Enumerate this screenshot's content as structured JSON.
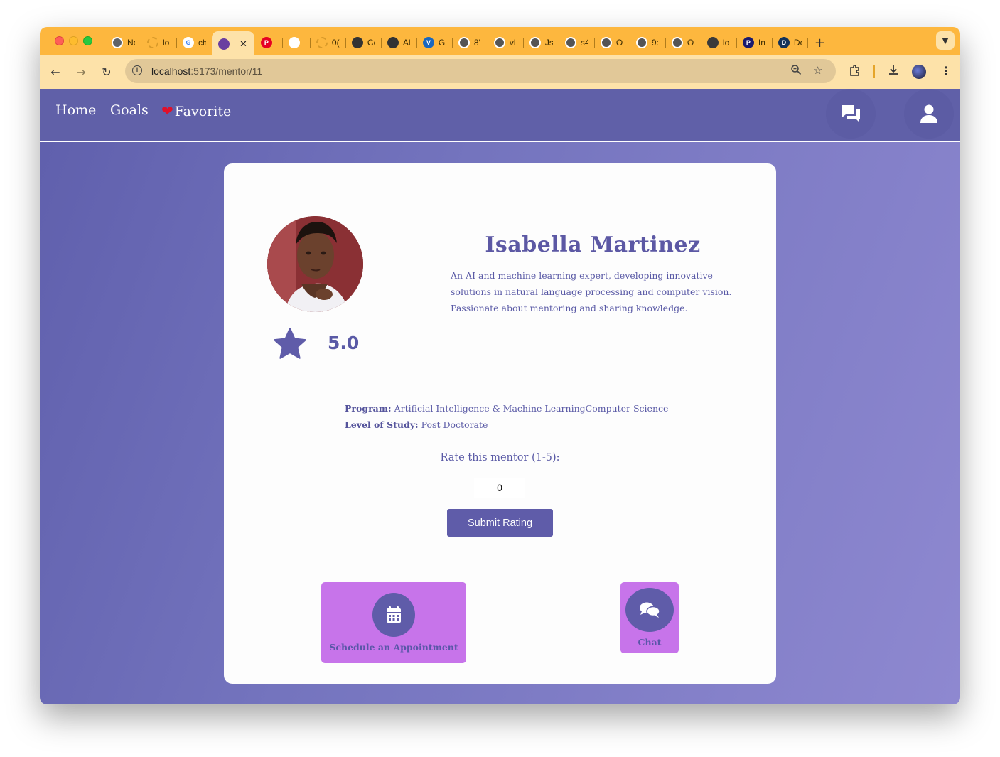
{
  "browser": {
    "tabs": [
      {
        "title": "Ne",
        "icon": "chrome-icon",
        "color": "#5f6368",
        "glyph": ""
      },
      {
        "title": "lo",
        "icon": "loading-icon",
        "color": "#d89a2a",
        "glyph": ""
      },
      {
        "title": "ch",
        "icon": "google-icon",
        "color": "#ffffff",
        "glyph": "G"
      },
      {
        "title": "",
        "icon": "app-icon",
        "color": "#6a3fa0",
        "glyph": "",
        "active": true
      },
      {
        "title": "",
        "icon": "pinterest-icon",
        "color": "#e60023",
        "glyph": "P"
      },
      {
        "title": "",
        "icon": "chat-bubble-icon",
        "color": "#ffffff",
        "glyph": ""
      },
      {
        "title": "0(",
        "icon": "loading-icon",
        "color": "#d89a2a",
        "glyph": ""
      },
      {
        "title": "Cc",
        "icon": "figma-icon",
        "color": "#333333",
        "glyph": ""
      },
      {
        "title": "Al",
        "icon": "figma-icon",
        "color": "#333333",
        "glyph": ""
      },
      {
        "title": "G",
        "icon": "vuetify-icon",
        "color": "#1867c0",
        "glyph": "V"
      },
      {
        "title": "8'",
        "icon": "globe-icon",
        "color": "#555555",
        "glyph": ""
      },
      {
        "title": "vl",
        "icon": "globe-icon",
        "color": "#555555",
        "glyph": ""
      },
      {
        "title": "Js",
        "icon": "globe-icon",
        "color": "#555555",
        "glyph": ""
      },
      {
        "title": "s4",
        "icon": "globe-icon",
        "color": "#555555",
        "glyph": ""
      },
      {
        "title": "O",
        "icon": "globe-icon",
        "color": "#555555",
        "glyph": ""
      },
      {
        "title": "9:",
        "icon": "globe-icon",
        "color": "#555555",
        "glyph": ""
      },
      {
        "title": "O",
        "icon": "globe-icon",
        "color": "#555555",
        "glyph": ""
      },
      {
        "title": "lo",
        "icon": "camera-icon",
        "color": "#3a3a3a",
        "glyph": ""
      },
      {
        "title": "In",
        "icon": "p-logo-icon",
        "color": "#1a1a6e",
        "glyph": "P"
      },
      {
        "title": "Dc",
        "icon": "d-logo-icon",
        "color": "#12325a",
        "glyph": "D"
      }
    ],
    "close_glyph": "✕",
    "new_tab_glyph": "+",
    "url_host": "localhost",
    "url_path": ":5173/mentor/11"
  },
  "nav": {
    "home": "Home",
    "goals": "Goals",
    "favorite": "Favorite",
    "heart": "❤"
  },
  "mentor": {
    "name": "Isabella Martinez",
    "bio": "An AI and machine learning expert, developing innovative solutions in natural language processing and computer vision. Passionate about mentoring and sharing knowledge.",
    "rating": "5.0",
    "program_label": "Program:",
    "program": "Artificial Intelligence & Machine LearningComputer Science",
    "level_label": "Level of Study:",
    "level": "Post Doctorate"
  },
  "rate": {
    "label": "Rate this mentor (1-5):",
    "value": "0",
    "submit": "Submit Rating"
  },
  "actions": {
    "schedule": "Schedule an Appointment",
    "chat": "Chat"
  },
  "colors": {
    "tab_bar": "#fdb73e",
    "navbar": "#6060a8",
    "primary": "#5f5ca9",
    "action_bg": "#c774ea"
  }
}
